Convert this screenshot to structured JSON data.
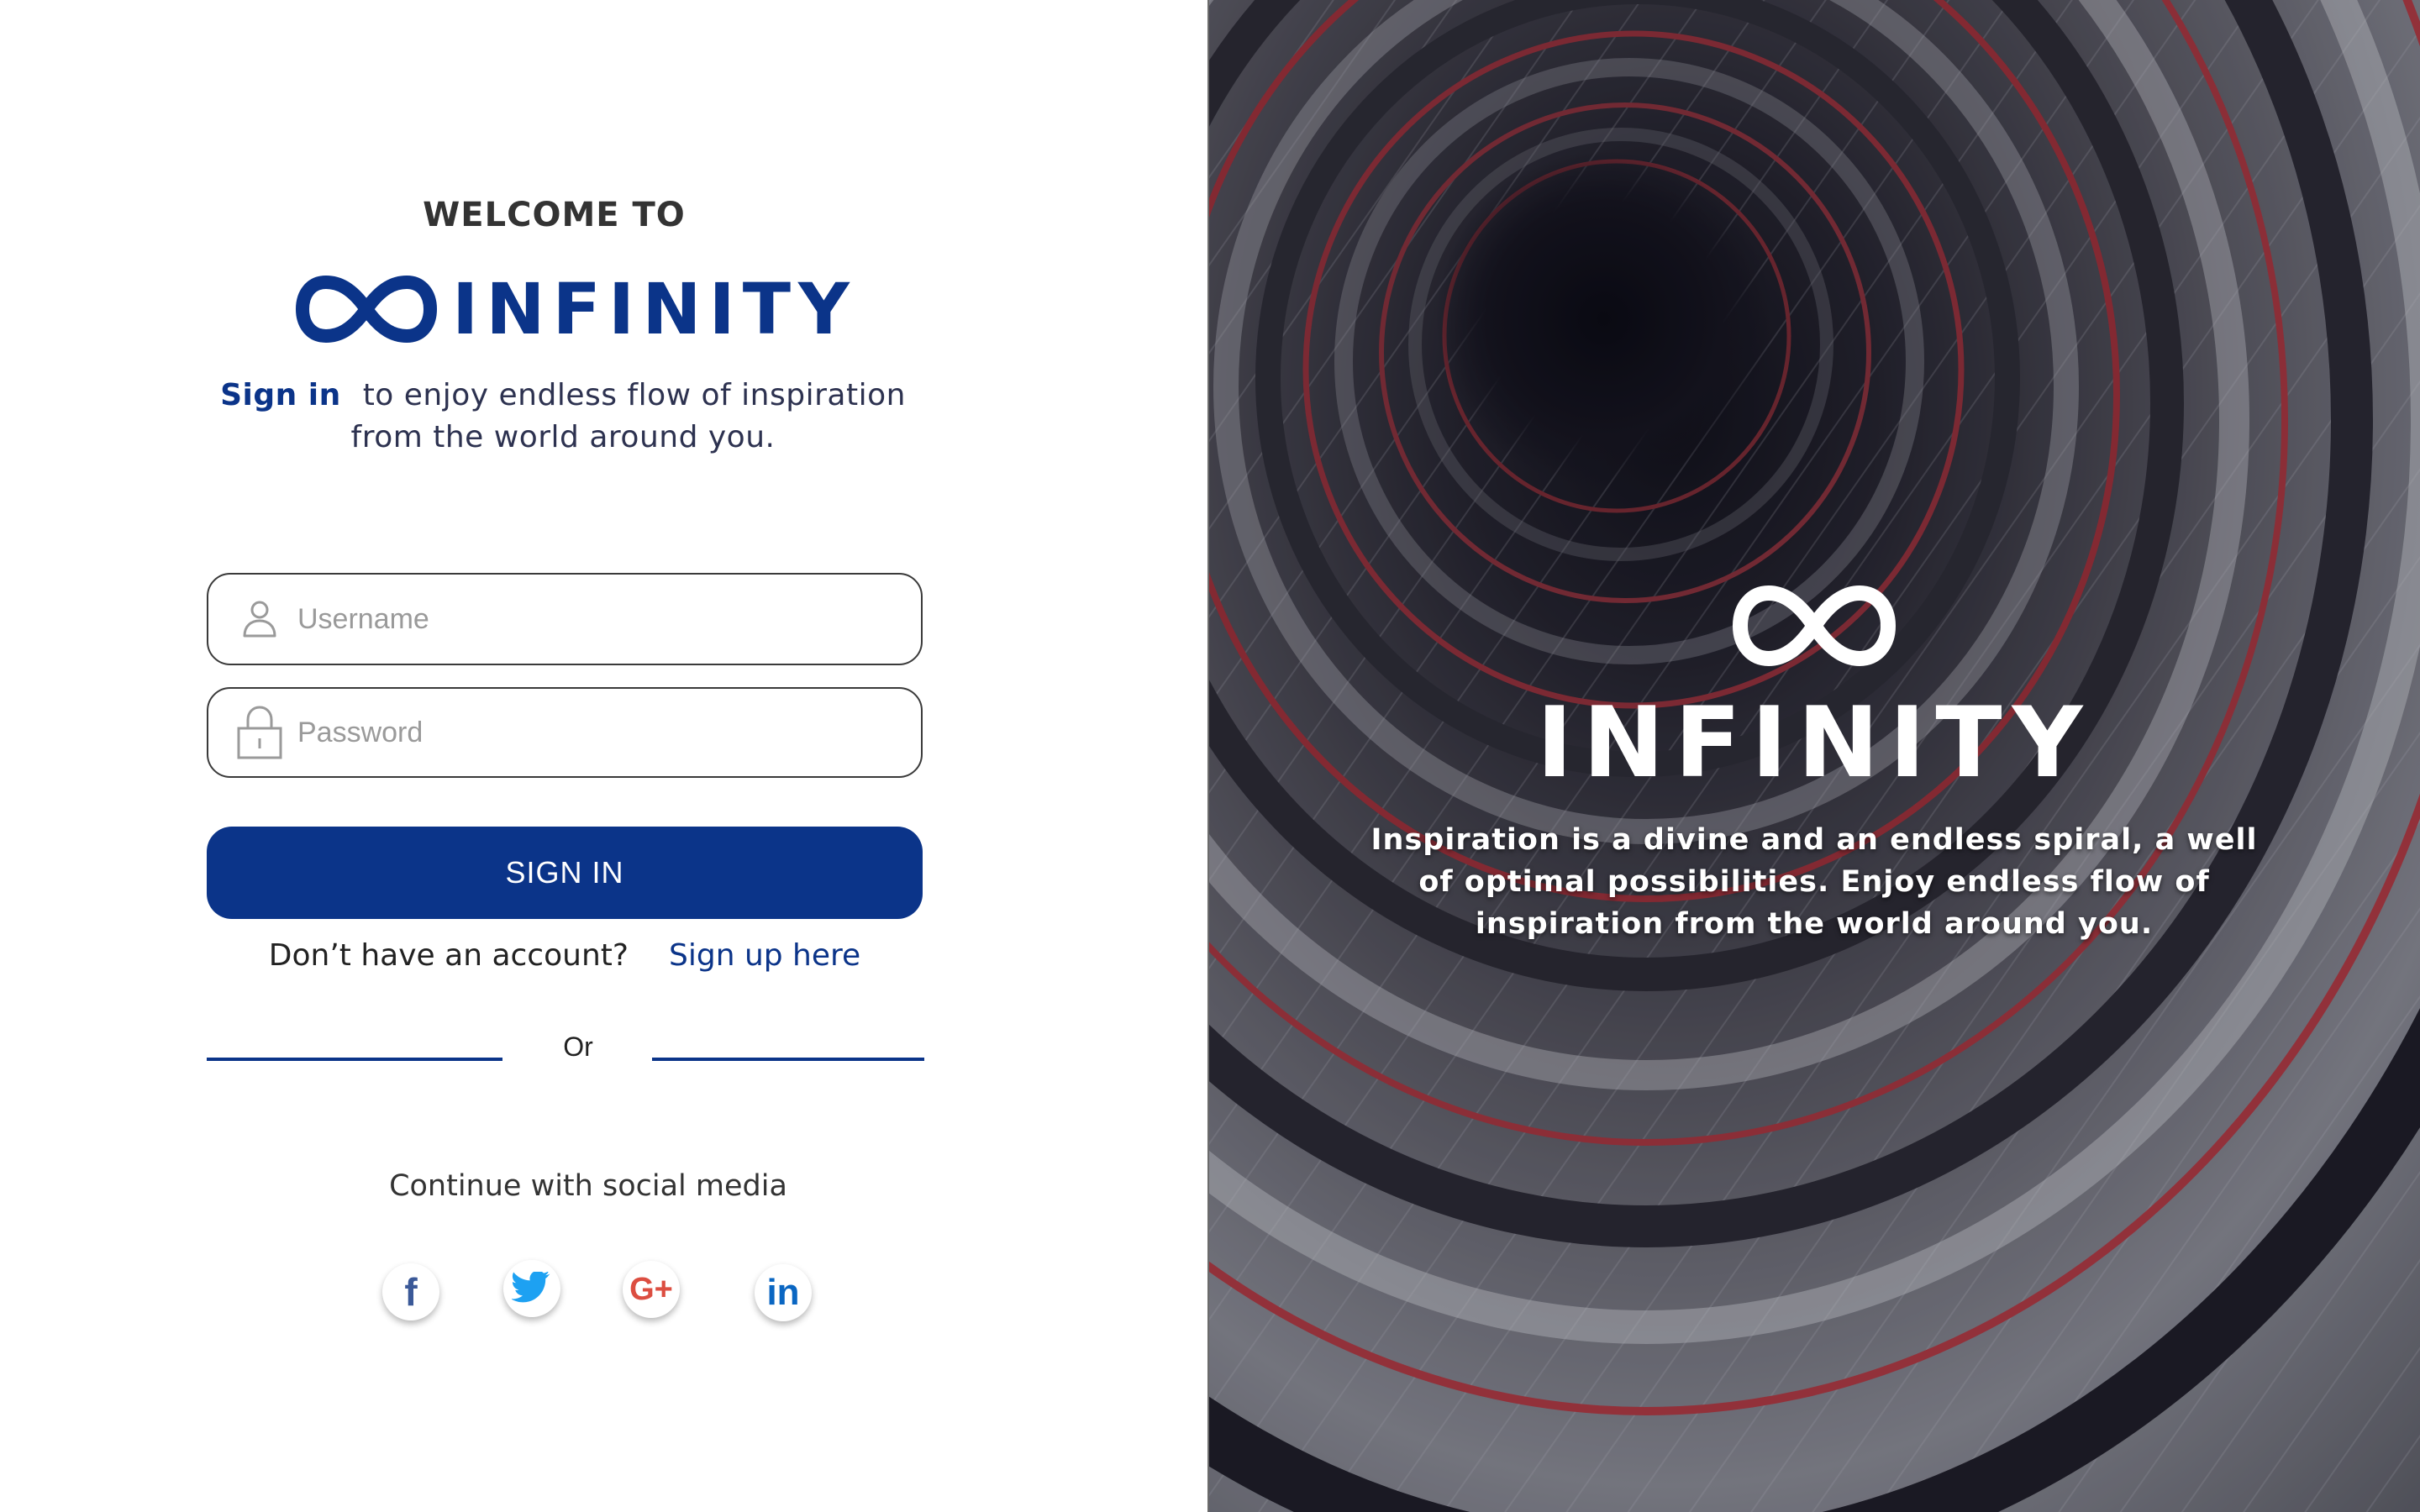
{
  "colors": {
    "brand_blue": "#0b3489",
    "text_dark": "#2d3250",
    "placeholder_gray": "#9a9a9a",
    "white": "#ffffff",
    "facebook": "#3b5998",
    "twitter": "#1da1f2",
    "google_plus": "#dc4e41",
    "linkedin": "#0a66c2"
  },
  "login": {
    "welcome": "WELCOME TO",
    "brand_name": "INFINITY",
    "tagline_link": "Sign in",
    "tagline_text": "to enjoy endless flow of inspiration from the world around you.",
    "username_placeholder": "Username",
    "password_placeholder": "Password",
    "sign_in_button": "SIGN IN",
    "no_account_text": "Don’t have an account?",
    "sign_up_link": "Sign up here",
    "divider_text": "Or",
    "social_label": "Continue with social media",
    "social": [
      {
        "name": "facebook-icon",
        "glyph": "f"
      },
      {
        "name": "twitter-icon",
        "glyph": "twitter-bird"
      },
      {
        "name": "google-plus-icon",
        "glyph": "G+"
      },
      {
        "name": "linkedin-icon",
        "glyph": "in"
      }
    ]
  },
  "hero": {
    "brand_name": "INFINITY",
    "description": "Inspiration is a divine and an endless spiral, a well of optimal possibilities. Enjoy endless flow of inspiration from the world around you.",
    "image": "spiral-staircase-photo"
  },
  "icons": {
    "logo": "infinity-logo-icon",
    "user": "user-icon",
    "lock": "lock-icon"
  }
}
